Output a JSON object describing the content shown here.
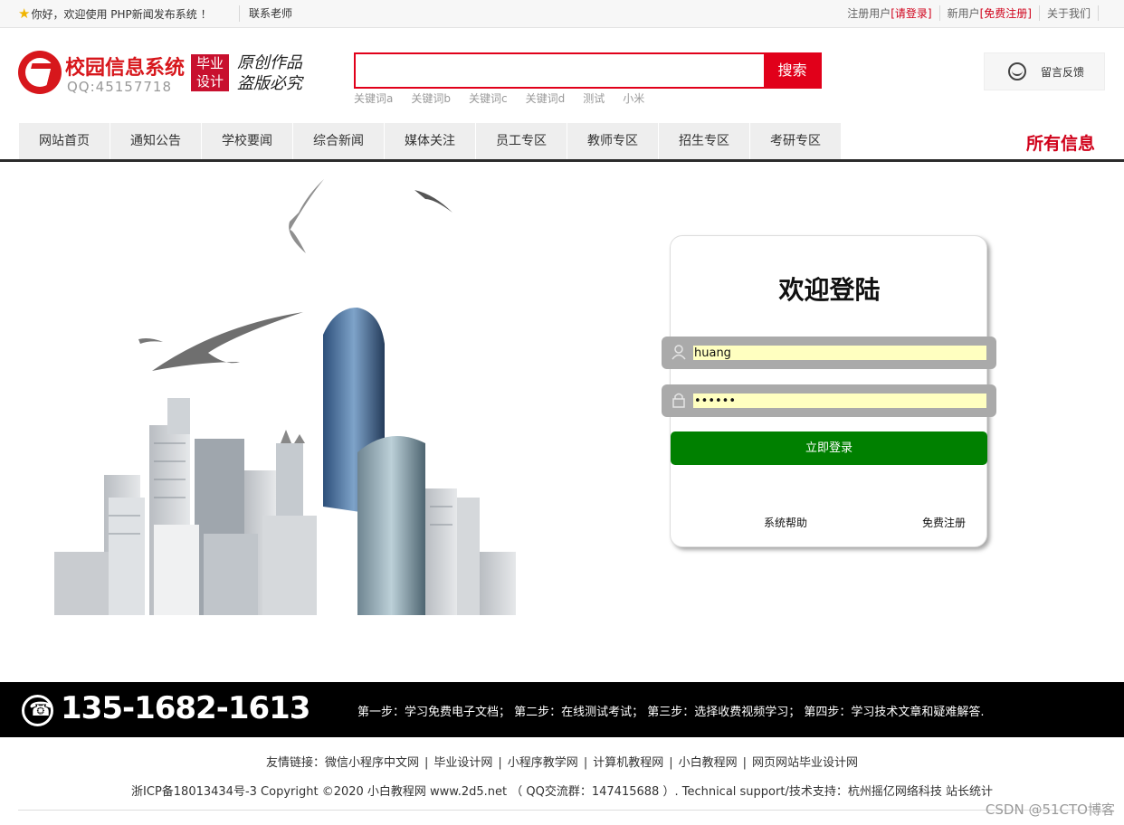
{
  "topbar": {
    "welcome": "你好，欢迎使用 PHP新闻发布系统 ！",
    "contact": "联系老师",
    "register_prefix": "注册用户",
    "register_link": "[请登录]",
    "new_user_prefix": "新用户",
    "new_user_link": "[免费注册]",
    "about": "关于我们"
  },
  "header": {
    "logo_title": "校园信息系统",
    "logo_qq": "QQ:45157718",
    "badge_line1": "毕业",
    "badge_line2": "设计",
    "slogan_line1": "原创作品",
    "slogan_line2": "盗版必究",
    "search_value": "",
    "search_button": "搜索",
    "keywords": [
      "关键词a",
      "关键词b",
      "关键词c",
      "关键词d",
      "测试",
      "小米"
    ],
    "feedback": "留言反馈"
  },
  "nav": {
    "tabs": [
      "网站首页",
      "通知公告",
      "学校要闻",
      "综合新闻",
      "媒体关注",
      "员工专区",
      "教师专区",
      "招生专区",
      "考研专区"
    ],
    "all": "所有信息"
  },
  "login": {
    "title": "欢迎登陆",
    "username": "huang",
    "password": "••••••",
    "submit": "立即登录",
    "help": "系统帮助",
    "register": "免费注册",
    "field_color": "#ffffc0",
    "button_color": "#008000"
  },
  "footer": {
    "phone": "135-1682-1613",
    "steps": "第一步：学习免费电子文档；   第二步：在线测试考试；   第三步：选择收费视频学习；   第四步：学习技术文章和疑难解答.",
    "friends_label": "友情链接：",
    "friends": [
      "微信小程序中文网",
      "毕业设计网",
      "小程序教学网",
      "计算机教程网",
      "小白教程网",
      "网页网站毕业设计网"
    ],
    "copyright": "浙ICP备18013434号-3 Copyright ©2020 小白教程网 www.2d5.net （ QQ交流群：147415688 ）. Technical support/技术支持：杭州摇亿网络科技 站长统计",
    "watermark": "CSDN @51CTO博客"
  }
}
